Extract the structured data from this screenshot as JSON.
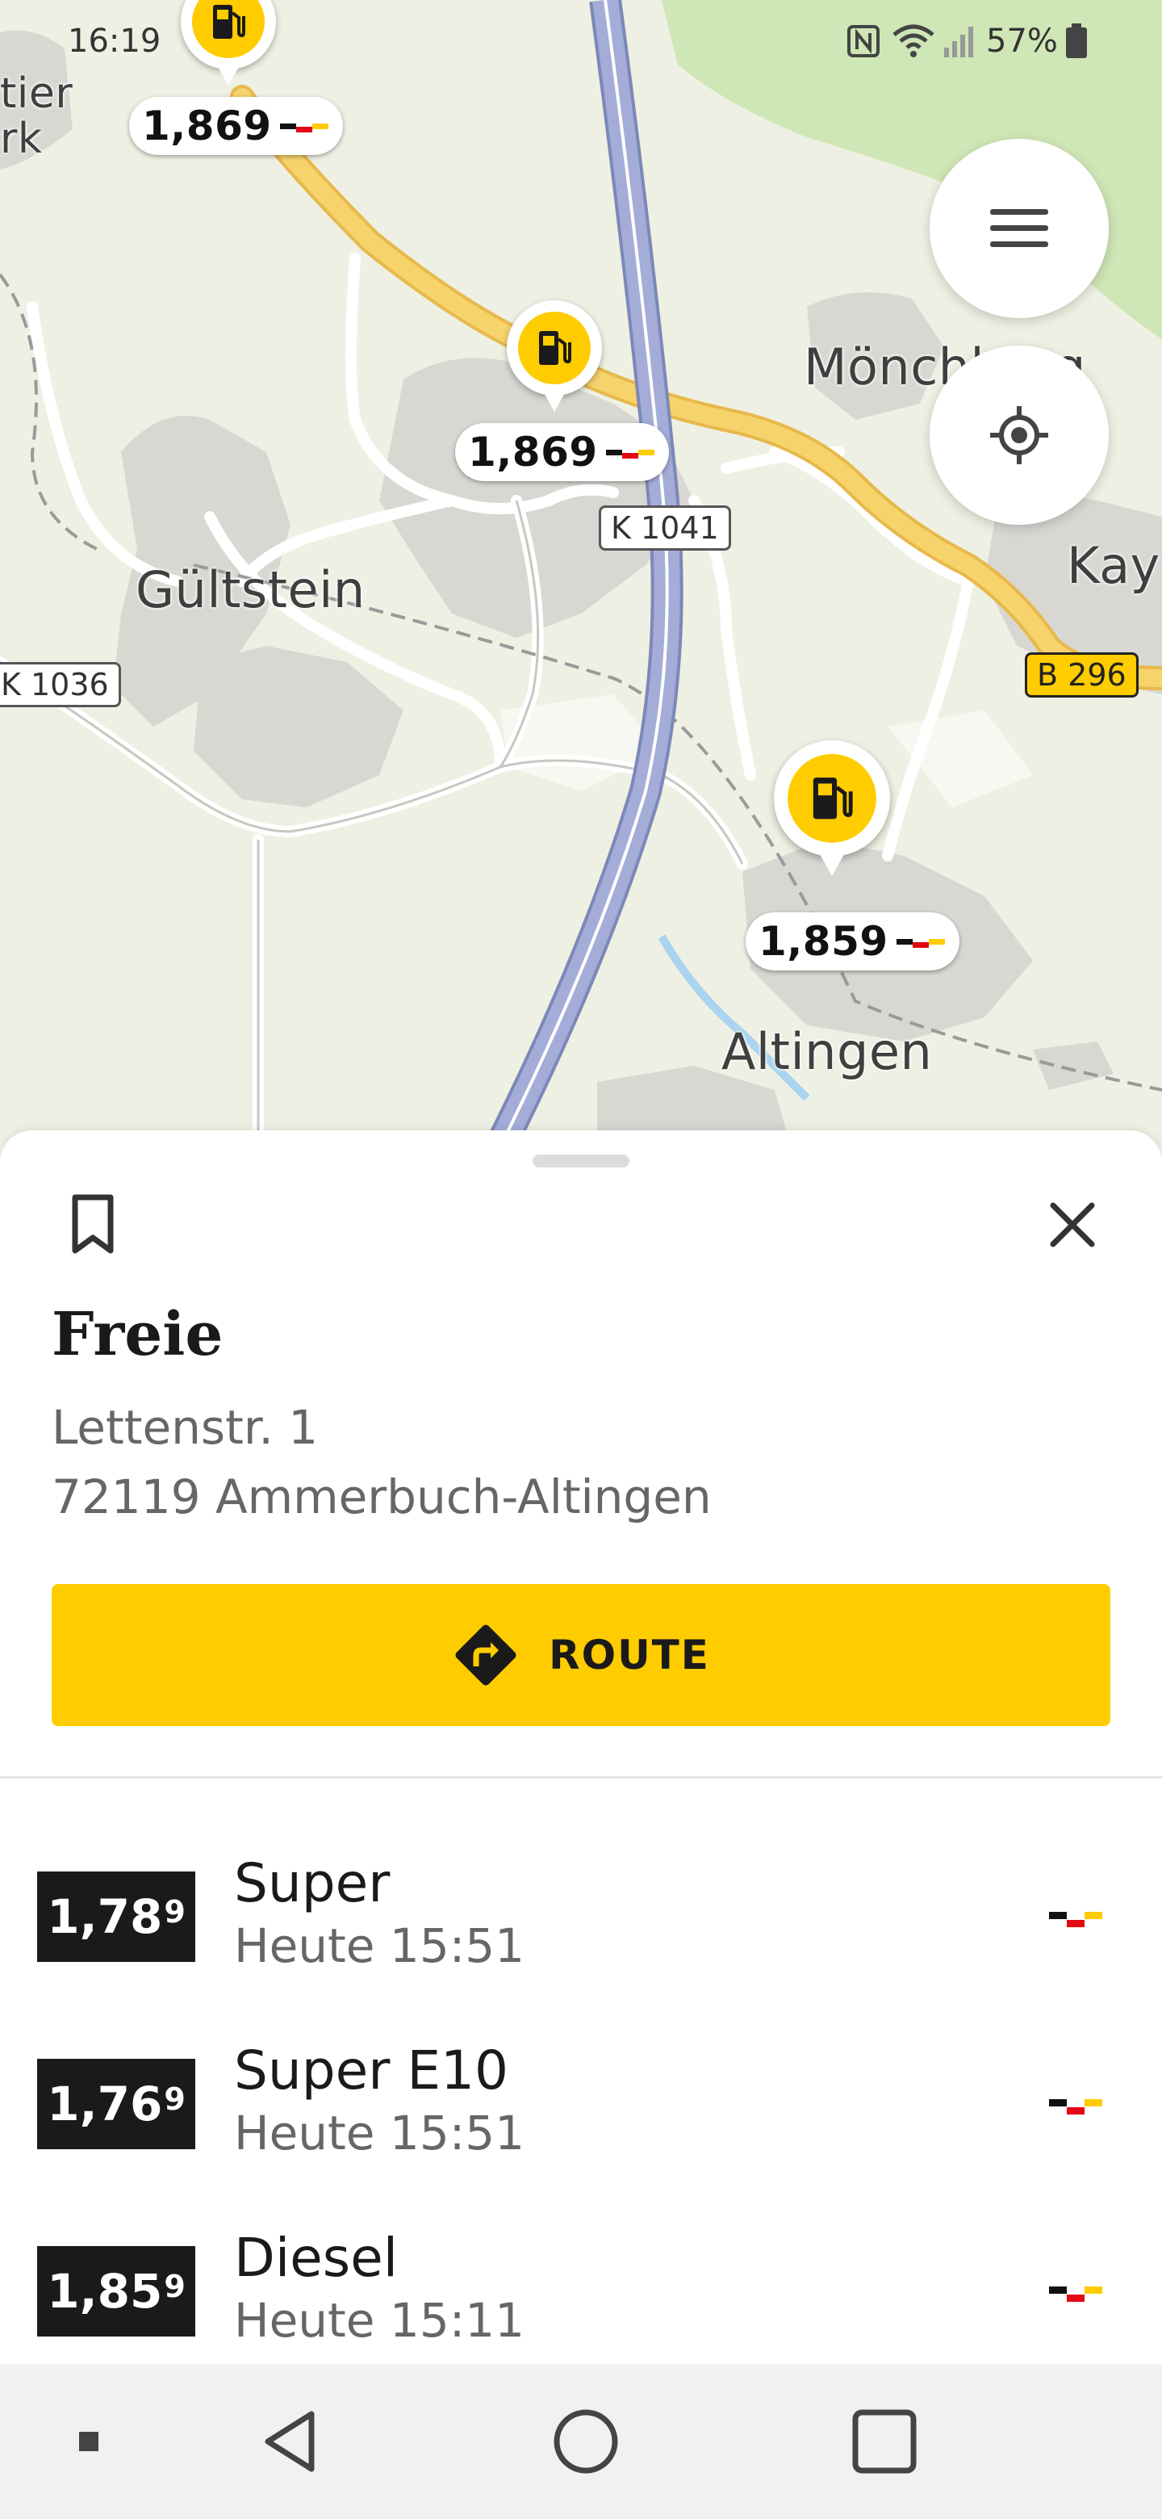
{
  "status_bar": {
    "time": "16:19",
    "battery": "57%",
    "icons": [
      "nfc-icon",
      "wifi-icon",
      "signal-icon",
      "battery-icon"
    ]
  },
  "map": {
    "labels": {
      "gueltstein": "Gültstein",
      "moenchberg": "Mönchberg",
      "kayh": "Kay",
      "altingen": "Altingen",
      "partial_top_left_1": "tier",
      "partial_top_left_2": "rk"
    },
    "road_tags": {
      "k1041": "K 1041",
      "k1036": "K 1036",
      "b296": "B 296"
    },
    "price_markers": [
      {
        "price": "1,869"
      },
      {
        "price": "1,869"
      },
      {
        "price": "1,859"
      }
    ],
    "flag_colors": [
      "#111111",
      "#e30613",
      "#ffcc00"
    ],
    "colors": {
      "motorway": "#98a3d4",
      "main_road": "#f6d36b",
      "settlement": "#d9d7d2",
      "forest": "#cfe6b6"
    }
  },
  "map_controls": {
    "menu_icon": "hamburger-menu-icon",
    "locate_icon": "locate-me-icon"
  },
  "station": {
    "name": "Freie",
    "street": "Lettenstr. 1",
    "city": "72119 Ammerbuch-Altingen",
    "route_label": "ROUTE"
  },
  "fuels": [
    {
      "price_main": "1,78",
      "price_sup": "9",
      "name": "Super",
      "time": "Heute 15:51"
    },
    {
      "price_main": "1,76",
      "price_sup": "9",
      "name": "Super E10",
      "time": "Heute 15:51"
    },
    {
      "price_main": "1,85",
      "price_sup": "9",
      "name": "Diesel",
      "time": "Heute 15:11"
    }
  ],
  "theme": {
    "accent": "#ffcc00",
    "text_dark": "#1a1a1a",
    "text_muted": "#666666"
  }
}
